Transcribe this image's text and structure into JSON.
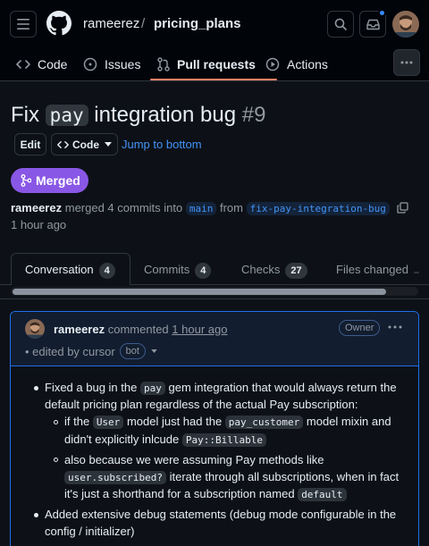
{
  "header": {
    "owner": "rameerez",
    "separator": "/",
    "repo": "pricing_plans",
    "has_notification": true
  },
  "nav": {
    "code": "Code",
    "issues": "Issues",
    "pull_requests": "Pull requests",
    "actions": "Actions",
    "active": "pull_requests"
  },
  "pr": {
    "title_pre": "Fix ",
    "title_code": "pay",
    "title_post": " integration bug",
    "number": "#9",
    "edit_label": "Edit",
    "code_label": "Code",
    "jump_label": "Jump to bottom",
    "status": "Merged",
    "author": "rameerez",
    "merge_text": "merged 4 commits into",
    "base_branch": "main",
    "from_text": "from",
    "head_branch": "fix-pay-integration-bug",
    "time": "1 hour ago"
  },
  "tabs": [
    {
      "label": "Conversation",
      "count": "4"
    },
    {
      "label": "Commits",
      "count": "4"
    },
    {
      "label": "Checks",
      "count": "27"
    },
    {
      "label": "Files changed",
      "count": ""
    }
  ],
  "comment": {
    "author": "rameerez",
    "action": "commented",
    "time": "1 hour ago",
    "role": "Owner",
    "edited_prefix": "• edited by cursor",
    "bot": "bot",
    "items": {
      "i1_a": "Fixed a bug in the",
      "i1_code": "pay",
      "i1_b": "gem integration that would always return the",
      "i1_c": "default pricing plan regardless of the actual Pay subscription:",
      "s1_a": "if the",
      "s1_code1": "User",
      "s1_b": "model just had the",
      "s1_code2": "pay_customer",
      "s1_c": "model mixin and",
      "s1_d": "didn't explicitly inlcude",
      "s1_code3": "Pay::Billable",
      "s2_a": "also because we were assuming Pay methods like",
      "s2_code1": "user.subscribed?",
      "s2_b": "iterate through all subscriptions, when in fact",
      "s2_c": "it's just a shorthand for a subscription named",
      "s2_code2": "default",
      "i2_a": "Added extensive debug statements (debug mode configurable in the",
      "i2_b": "config / initializer)"
    }
  },
  "colors": {
    "accent": "#4493f8",
    "merged": "#8957e5",
    "tab_underline": "#f78166",
    "background": "#0d1117"
  }
}
